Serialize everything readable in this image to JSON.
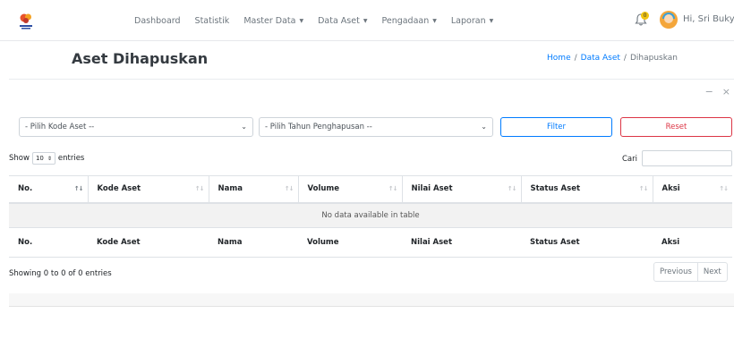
{
  "nav": {
    "items": [
      {
        "label": "Dashboard",
        "dropdown": false
      },
      {
        "label": "Statistik",
        "dropdown": false
      },
      {
        "label": "Master Data",
        "dropdown": true
      },
      {
        "label": "Data Aset",
        "dropdown": true
      },
      {
        "label": "Pengadaan",
        "dropdown": true
      },
      {
        "label": "Laporan",
        "dropdown": true
      }
    ],
    "notification_count": "0",
    "user_greeting": "Hi, Sri Bukya"
  },
  "page": {
    "title": "Aset Dihapuskan",
    "breadcrumb": [
      "Home",
      "Data Aset",
      "Dihapuskan"
    ]
  },
  "card_tools": {
    "collapse": "−",
    "close": "×"
  },
  "filters": {
    "kode_aset": {
      "selected": "- Pilih Kode Aset --"
    },
    "tahun": {
      "selected": "- Pilih Tahun Penghapusan --"
    },
    "filter_label": "Filter",
    "reset_label": "Reset"
  },
  "table_controls": {
    "show_label": "Show",
    "entries_value": "10",
    "entries_label": "entries",
    "search_label": "Cari",
    "search_value": ""
  },
  "table": {
    "columns": [
      "No.",
      "Kode Aset",
      "Nama",
      "Volume",
      "Nilai Aset",
      "Status Aset",
      "Aksi"
    ],
    "empty_message": "No data available in table",
    "info": "Showing 0 to 0 of 0 entries",
    "pagination": {
      "previous": "Previous",
      "next": "Next"
    }
  },
  "colors": {
    "primary": "#007bff",
    "danger": "#dc3545",
    "badge": "#f1c40f"
  }
}
